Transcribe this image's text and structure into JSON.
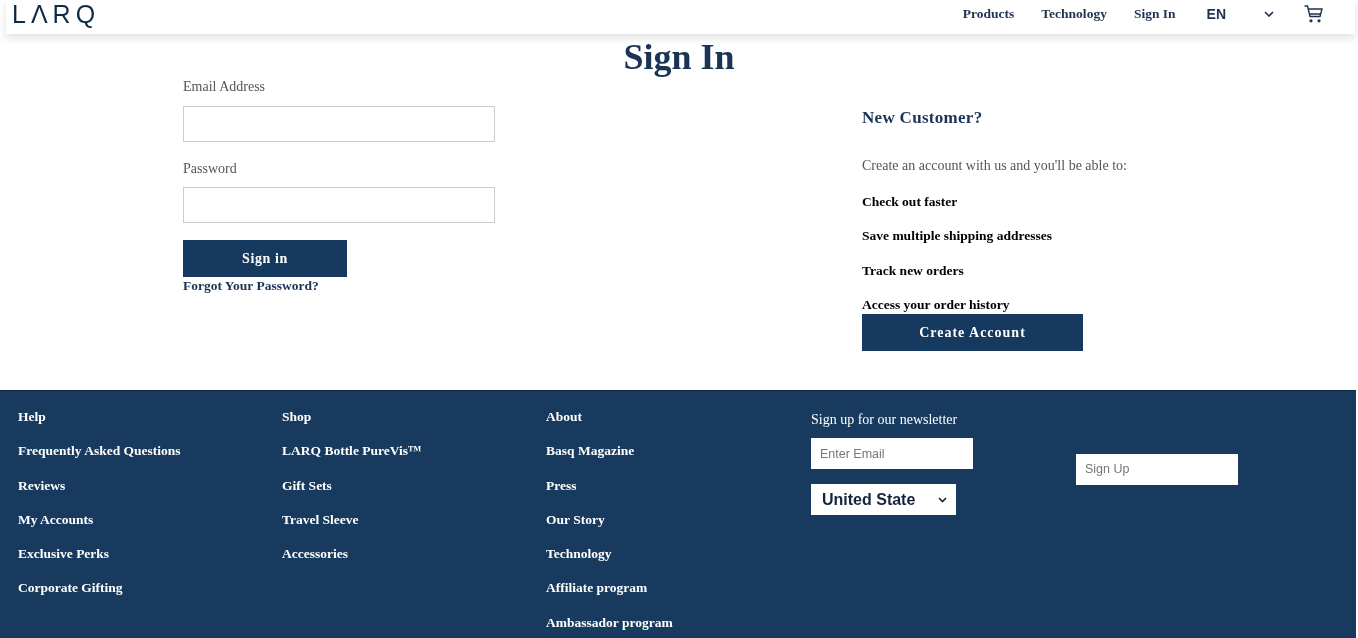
{
  "header": {
    "logo": "LΛRQ",
    "nav": [
      "Products",
      "Technology",
      "Sign In"
    ],
    "language": "EN"
  },
  "page_title": "Sign In",
  "sign_in": {
    "fields": [
      {
        "label": "Email Address"
      },
      {
        "label": "Password"
      }
    ],
    "button": "Sign in",
    "forgot_link": "Forgot Your Password?"
  },
  "new_customer": {
    "heading": "New Customer?",
    "intro": "Create an account with us and you'll be able to:",
    "benefits": [
      "Check out faster",
      "Save multiple shipping addresses",
      "Track new orders",
      "Access your order history"
    ],
    "button": "Create Account"
  },
  "footer": {
    "columns": [
      {
        "heading": "Help",
        "links": [
          "Frequently Asked Questions",
          "Reviews",
          "My Accounts",
          "Exclusive Perks",
          "Corporate Gifting"
        ]
      },
      {
        "heading": "Shop",
        "links": [
          "LARQ Bottle PureVis™",
          "Gift Sets",
          "Travel Sleeve",
          "Accessories"
        ]
      },
      {
        "heading": "About",
        "links": [
          "Basq Magazine",
          "Press",
          "Our Story",
          "Technology",
          "Affiliate program",
          "Ambassador program"
        ]
      }
    ],
    "newsletter": {
      "heading": "Sign up for our newsletter",
      "email_placeholder": "Enter Email",
      "country": "United State",
      "button": "Sign Up"
    }
  }
}
